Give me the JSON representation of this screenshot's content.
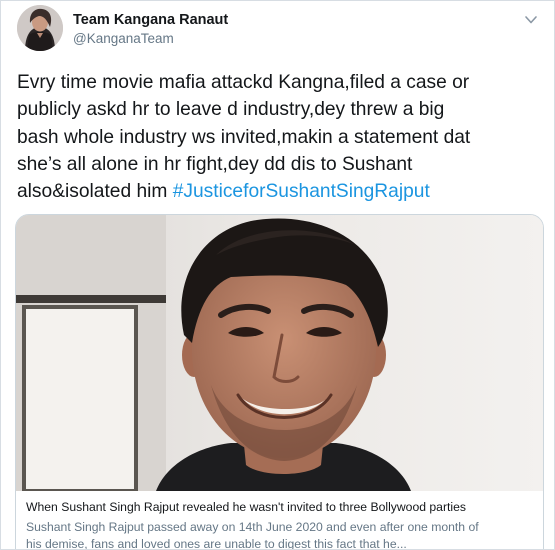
{
  "tweet": {
    "author": {
      "name": "Team Kangana Ranaut",
      "handle": "@KanganaTeam"
    },
    "text_lines": [
      "Evry time movie mafia attackd Kangna,filed a case or",
      "publicly askd hr to leave d industry,dey threw a big",
      "bash whole industry ws invited,makin a statement dat",
      "she’s all alone in hr fight,dey dd dis to Sushant",
      "also&isolated him "
    ],
    "hashtag": "#JusticeforSushantSingRajput"
  },
  "card": {
    "title": "When Sushant Singh Rajput revealed he wasn't invited to three Bollywood parties",
    "description_lines": [
      "Sushant Singh Rajput passed away on 14th June 2020 and even after one month of",
      "his demise, fans and loved ones are unable to digest this fact that he..."
    ]
  },
  "colors": {
    "text": "#14171a",
    "muted": "#657786",
    "link": "#1b95e0",
    "border": "#ccd6dd"
  },
  "icons": {
    "caret": "chevron-down-icon",
    "avatar": "profile-photo"
  }
}
